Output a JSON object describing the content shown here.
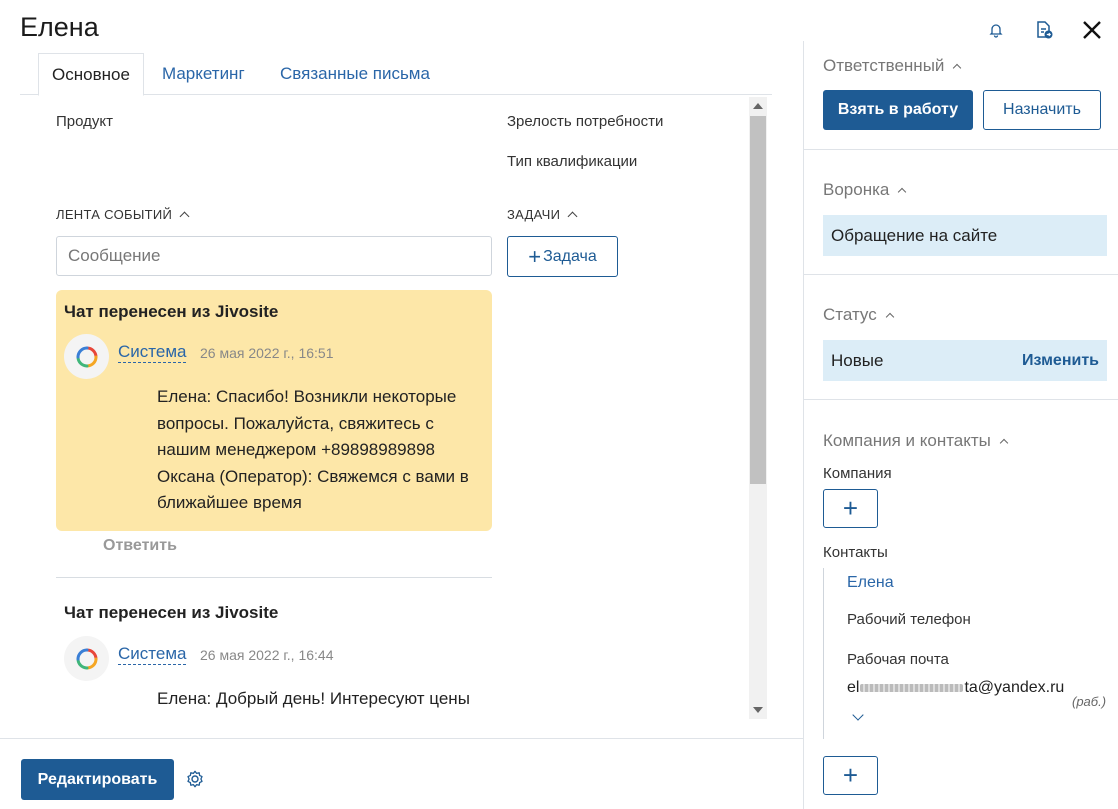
{
  "header": {
    "title": "Елена"
  },
  "tabs": [
    {
      "label": "Основное"
    },
    {
      "label": "Маркетинг"
    },
    {
      "label": "Связанные письма"
    }
  ],
  "main": {
    "fields": {
      "product": "Продукт",
      "maturity": "Зрелость потребности",
      "qualification": "Тип квалификации"
    },
    "feed": {
      "title": "ЛЕНТА СОБЫТИЙ",
      "placeholder": "Сообщение",
      "events": [
        {
          "title": "Чат перенесен из Jivosite",
          "author": "Система",
          "date": "26 мая 2022 г., 16:51",
          "lines": [
            "Елена: Спасибо! Возникли некоторые",
            "вопросы. Пожалуйста, свяжитесь с",
            "нашим менеджером +89898989898",
            "Оксана (Оператор): Свяжемся с вами в",
            "ближайшее время"
          ],
          "reply": "Ответить"
        },
        {
          "title": "Чат перенесен из Jivosite",
          "author": "Система",
          "date": "26 мая 2022 г., 16:44",
          "lines": [
            "Елена: Добрый день! Интересуют цены"
          ]
        }
      ]
    },
    "tasks": {
      "title": "ЗАДАЧИ",
      "add_label": "Задача"
    }
  },
  "bottom": {
    "edit_label": "Редактировать"
  },
  "right": {
    "responsible": {
      "title": "Ответственный",
      "take_label": "Взять в работу",
      "assign_label": "Назначить"
    },
    "funnel": {
      "title": "Воронка",
      "value": "Обращение на сайте"
    },
    "status": {
      "title": "Статус",
      "value": "Новые",
      "change_label": "Изменить"
    },
    "company_contacts": {
      "title": "Компания и контакты",
      "company_label": "Компания",
      "contacts_label": "Контакты",
      "contact": {
        "name": "Елена",
        "phone_label": "Рабочий телефон",
        "email_label": "Рабочая почта",
        "email_start": "el",
        "email_end": "ta@yandex.ru",
        "email_type": "(раб.)"
      }
    }
  },
  "colors": {
    "accent": "#1e5b94",
    "link": "#2a66a8",
    "event_highlight": "#fde7a8",
    "value_box": "#dcedf7"
  }
}
